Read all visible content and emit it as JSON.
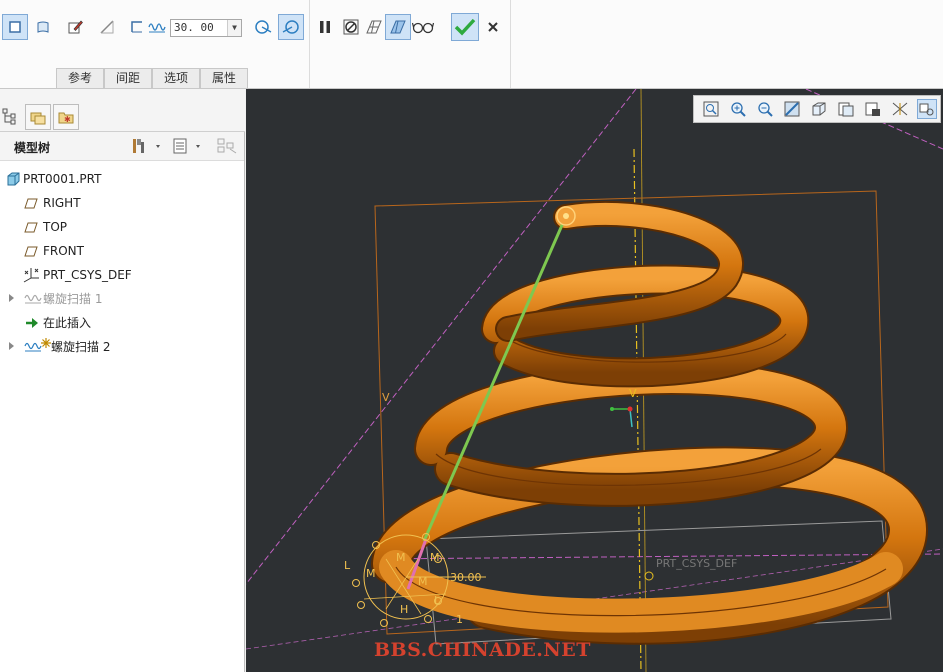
{
  "dashboard": {
    "value": "30. 00",
    "tabs": [
      "参考",
      "间距",
      "选项",
      "属性"
    ]
  },
  "model_tree": {
    "title": "模型树",
    "items": [
      {
        "label": "PRT0001.PRT",
        "icon": "part-icon"
      },
      {
        "label": "RIGHT",
        "icon": "datum-plane-icon"
      },
      {
        "label": "TOP",
        "icon": "datum-plane-icon"
      },
      {
        "label": "FRONT",
        "icon": "datum-plane-icon"
      },
      {
        "label": "PRT_CSYS_DEF",
        "icon": "csys-icon"
      },
      {
        "label": "螺旋扫描 1",
        "icon": "helical-sweep-icon"
      },
      {
        "label": "在此插入",
        "icon": "insert-here-arrow-icon"
      },
      {
        "label": "螺旋扫描 2",
        "icon": "helical-sweep-icon"
      }
    ]
  },
  "viewport": {
    "labels": {
      "v_left": "V",
      "v_center": "V",
      "dimension": "30.00",
      "csys": "PRT_CSYS_DEF",
      "m": "M",
      "l": "L",
      "h": "H",
      "one": "1"
    },
    "watermark": "BBS.CHINADE.NET"
  },
  "colors": {
    "spring": "#d4760f",
    "trajectory": "#7ec850",
    "background": "#2d3033",
    "watermark": "#d4422e"
  }
}
